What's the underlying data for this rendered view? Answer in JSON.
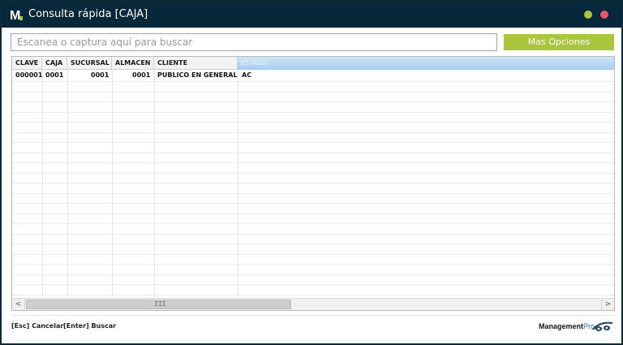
{
  "window": {
    "title": "Consulta rápida [CAJA]",
    "logo_letter": "M",
    "accent": "#a9c63c",
    "titlebar_color": "#06283a",
    "close_color": "#e9546b"
  },
  "search": {
    "placeholder": "Escanea o captura aquí para buscar",
    "value": ""
  },
  "toolbar": {
    "more_options_label": "Mas Opciones"
  },
  "table": {
    "columns": [
      "CLAVE",
      "CAJA",
      "SUCURSAL",
      "ALMACEN",
      "CLIENTE",
      "ESTADO"
    ],
    "rows": [
      [
        "000001",
        "0001",
        "0001",
        "0001",
        "PUBLICO EN GENERAL",
        "AC"
      ]
    ]
  },
  "scrollbar": {
    "left_arrow": "<",
    "right_arrow": ">",
    "grip": "III"
  },
  "footer": {
    "cancel_hint": "[Esc] Cancelar",
    "search_hint": "[Enter] Buscar",
    "brand_main": "Management",
    "brand_suffix": "Pro"
  }
}
